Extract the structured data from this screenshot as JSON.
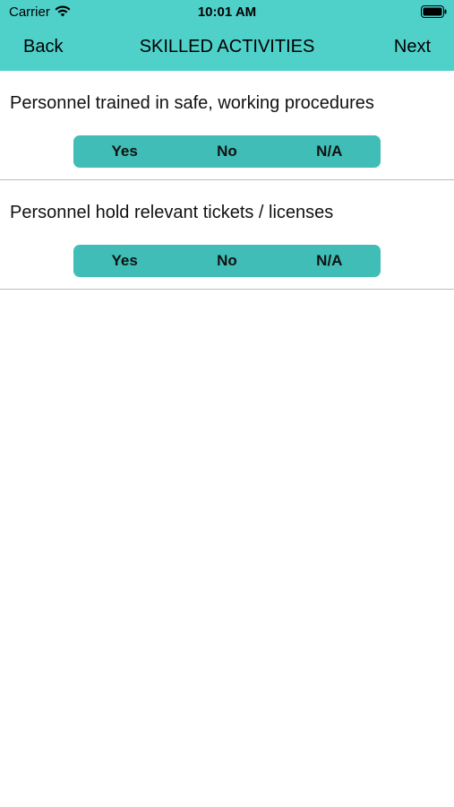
{
  "status_bar": {
    "carrier": "Carrier",
    "time": "10:01 AM",
    "wifi_icon": "wifi-icon",
    "battery_icon": "battery-icon"
  },
  "nav": {
    "back_label": "Back",
    "title": "SKILLED ACTIVITIES",
    "next_label": "Next"
  },
  "questions": [
    {
      "text": "Personnel trained in safe, working procedures",
      "options": [
        "Yes",
        "No",
        "N/A"
      ]
    },
    {
      "text": "Personnel hold relevant tickets / licenses",
      "options": [
        "Yes",
        "No",
        "N/A"
      ]
    }
  ],
  "colors": {
    "header": "#4fd0c9",
    "segment": "#3fbdb6",
    "divider": "#bdbdbd"
  }
}
